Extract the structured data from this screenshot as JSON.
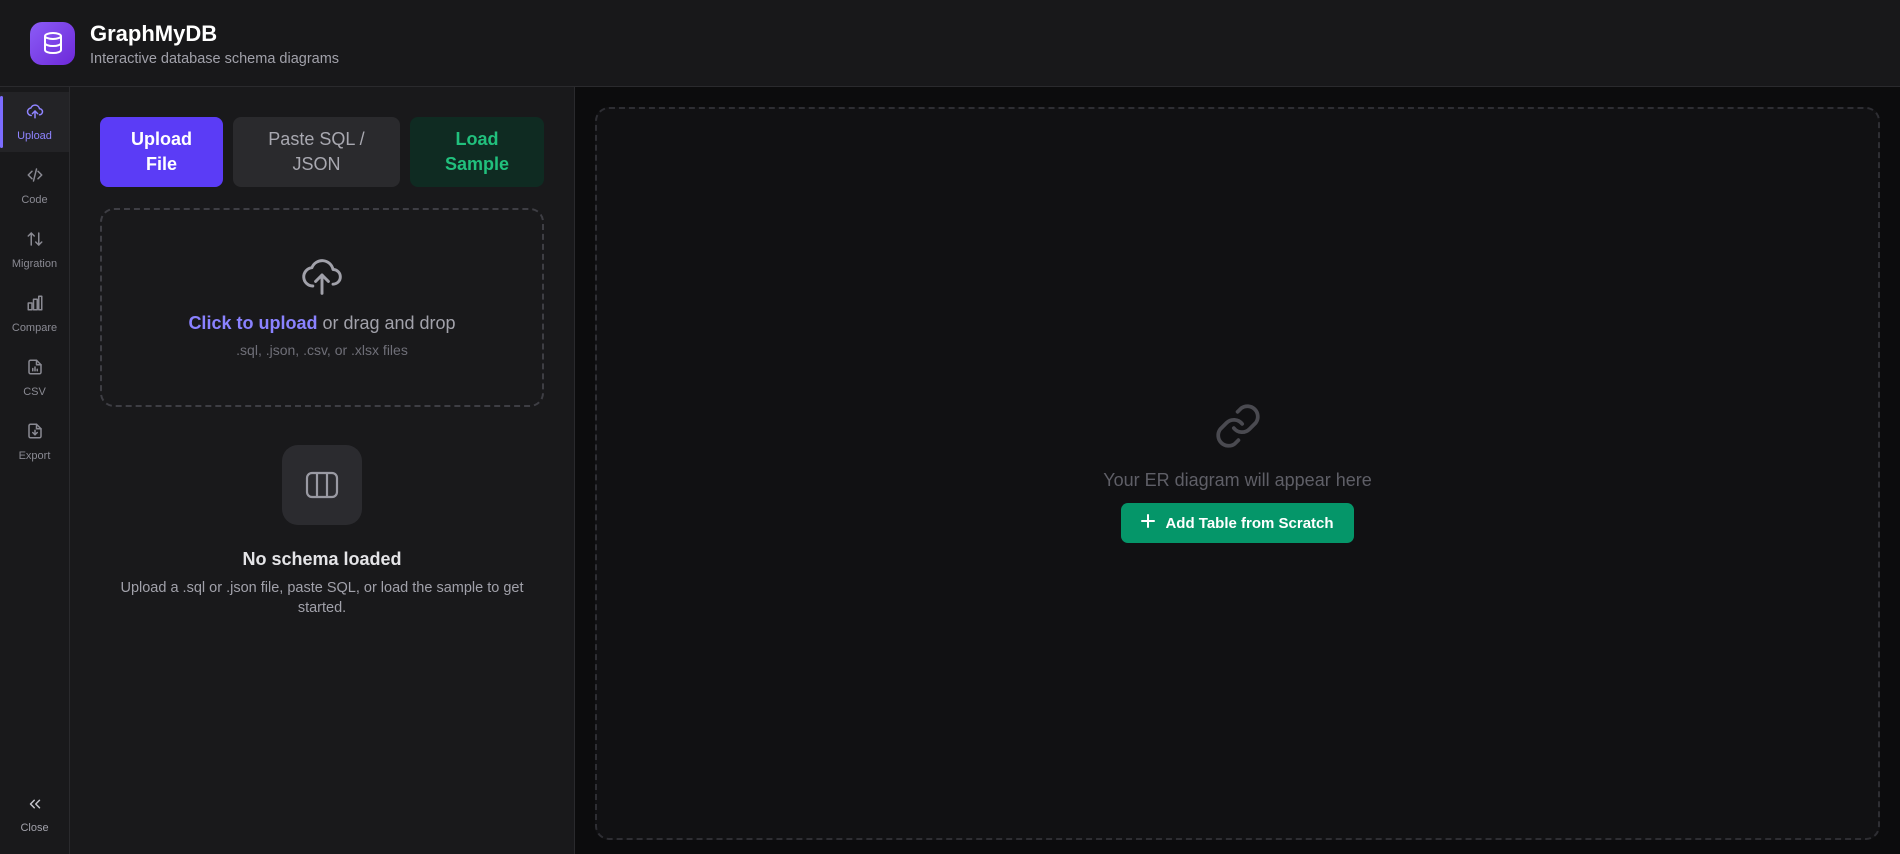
{
  "header": {
    "title": "GraphMyDB",
    "subtitle": "Interactive database schema diagrams",
    "logo_icon": "database-icon"
  },
  "rail": {
    "items": [
      {
        "label": "Upload",
        "icon": "cloud-upload-icon",
        "active": true
      },
      {
        "label": "Code",
        "icon": "code-icon"
      },
      {
        "label": "Migration",
        "icon": "arrows-up-down-icon"
      },
      {
        "label": "Compare",
        "icon": "bar-chart-icon"
      },
      {
        "label": "CSV",
        "icon": "file-chart-icon"
      },
      {
        "label": "Export",
        "icon": "file-download-icon"
      }
    ],
    "close_label": "Close"
  },
  "panel": {
    "tabs": {
      "upload": "Upload File",
      "paste": "Paste SQL / JSON",
      "sample": "Load Sample"
    },
    "dropzone": {
      "link": "Click to upload",
      "text": " or drag and drop",
      "hint": ".sql, .json, .csv, or .xlsx files"
    },
    "empty": {
      "title": "No schema loaded",
      "description": "Upload a .sql or .json file, paste SQL, or load the sample to get started."
    }
  },
  "canvas": {
    "message": "Your ER diagram will appear here",
    "add_button": "Add Table from Scratch"
  },
  "colors": {
    "accent": "#5b3cf6",
    "success": "#059669",
    "link": "#8a82ff"
  }
}
